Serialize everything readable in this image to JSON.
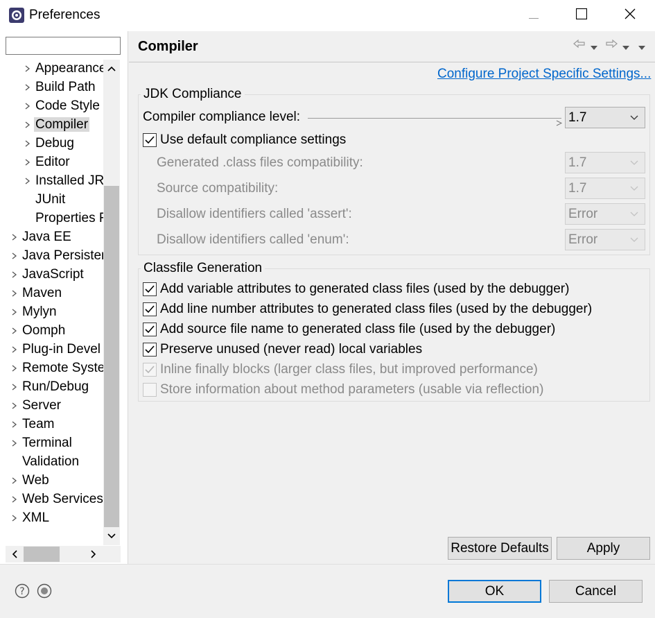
{
  "window": {
    "title": "Preferences",
    "minimize_icon": "minimize-icon",
    "maximize_icon": "maximize-icon",
    "close_icon": "close-icon"
  },
  "filter": {
    "value": "",
    "placeholder": ""
  },
  "tree": {
    "items": [
      {
        "label": "Appearance",
        "expandable": true,
        "level": 1
      },
      {
        "label": "Build Path",
        "expandable": true,
        "level": 1
      },
      {
        "label": "Code Style",
        "expandable": true,
        "level": 1
      },
      {
        "label": "Compiler",
        "expandable": true,
        "level": 1,
        "selected": true
      },
      {
        "label": "Debug",
        "expandable": true,
        "level": 1
      },
      {
        "label": "Editor",
        "expandable": true,
        "level": 1
      },
      {
        "label": "Installed JR",
        "expandable": true,
        "level": 1
      },
      {
        "label": "JUnit",
        "expandable": false,
        "level": 1
      },
      {
        "label": "Properties F",
        "expandable": false,
        "level": 1
      },
      {
        "label": "Java EE",
        "expandable": true,
        "level": 0
      },
      {
        "label": "Java Persisten",
        "expandable": true,
        "level": 0
      },
      {
        "label": "JavaScript",
        "expandable": true,
        "level": 0
      },
      {
        "label": "Maven",
        "expandable": true,
        "level": 0
      },
      {
        "label": "Mylyn",
        "expandable": true,
        "level": 0
      },
      {
        "label": "Oomph",
        "expandable": true,
        "level": 0
      },
      {
        "label": "Plug-in Devel",
        "expandable": true,
        "level": 0
      },
      {
        "label": "Remote Syste",
        "expandable": true,
        "level": 0
      },
      {
        "label": "Run/Debug",
        "expandable": true,
        "level": 0
      },
      {
        "label": "Server",
        "expandable": true,
        "level": 0
      },
      {
        "label": "Team",
        "expandable": true,
        "level": 0
      },
      {
        "label": "Terminal",
        "expandable": true,
        "level": 0
      },
      {
        "label": "Validation",
        "expandable": false,
        "level": 0
      },
      {
        "label": "Web",
        "expandable": true,
        "level": 0
      },
      {
        "label": "Web Services",
        "expandable": true,
        "level": 0
      },
      {
        "label": "XML",
        "expandable": true,
        "level": 0
      }
    ]
  },
  "page": {
    "title": "Compiler",
    "configure_link": "Configure Project Specific Settings...",
    "jdk_group": {
      "title": "JDK Compliance",
      "compliance_label": "Compiler compliance level:",
      "compliance_value": "1.7",
      "use_default_label": "Use default compliance settings",
      "use_default_checked": true,
      "generated_label": "Generated .class files compatibility:",
      "generated_value": "1.7",
      "source_label": "Source compatibility:",
      "source_value": "1.7",
      "assert_label": "Disallow identifiers called 'assert':",
      "assert_value": "Error",
      "enum_label": "Disallow identifiers called 'enum':",
      "enum_value": "Error"
    },
    "classfile_group": {
      "title": "Classfile Generation",
      "options": [
        {
          "label": "Add variable attributes to generated class files (used by the debugger)",
          "checked": true,
          "enabled": true
        },
        {
          "label": "Add line number attributes to generated class files (used by the debugger)",
          "checked": true,
          "enabled": true
        },
        {
          "label": "Add source file name to generated class file (used by the debugger)",
          "checked": true,
          "enabled": true
        },
        {
          "label": "Preserve unused (never read) local variables",
          "checked": true,
          "enabled": true
        },
        {
          "label": "Inline finally blocks (larger class files, but improved performance)",
          "checked": true,
          "enabled": false
        },
        {
          "label": "Store information about method parameters (usable via reflection)",
          "checked": false,
          "enabled": false
        }
      ]
    },
    "restore_defaults": "Restore Defaults",
    "apply": "Apply"
  },
  "footer": {
    "ok": "OK",
    "cancel": "Cancel",
    "help_icon": "help-icon",
    "record_icon": "record-icon"
  }
}
